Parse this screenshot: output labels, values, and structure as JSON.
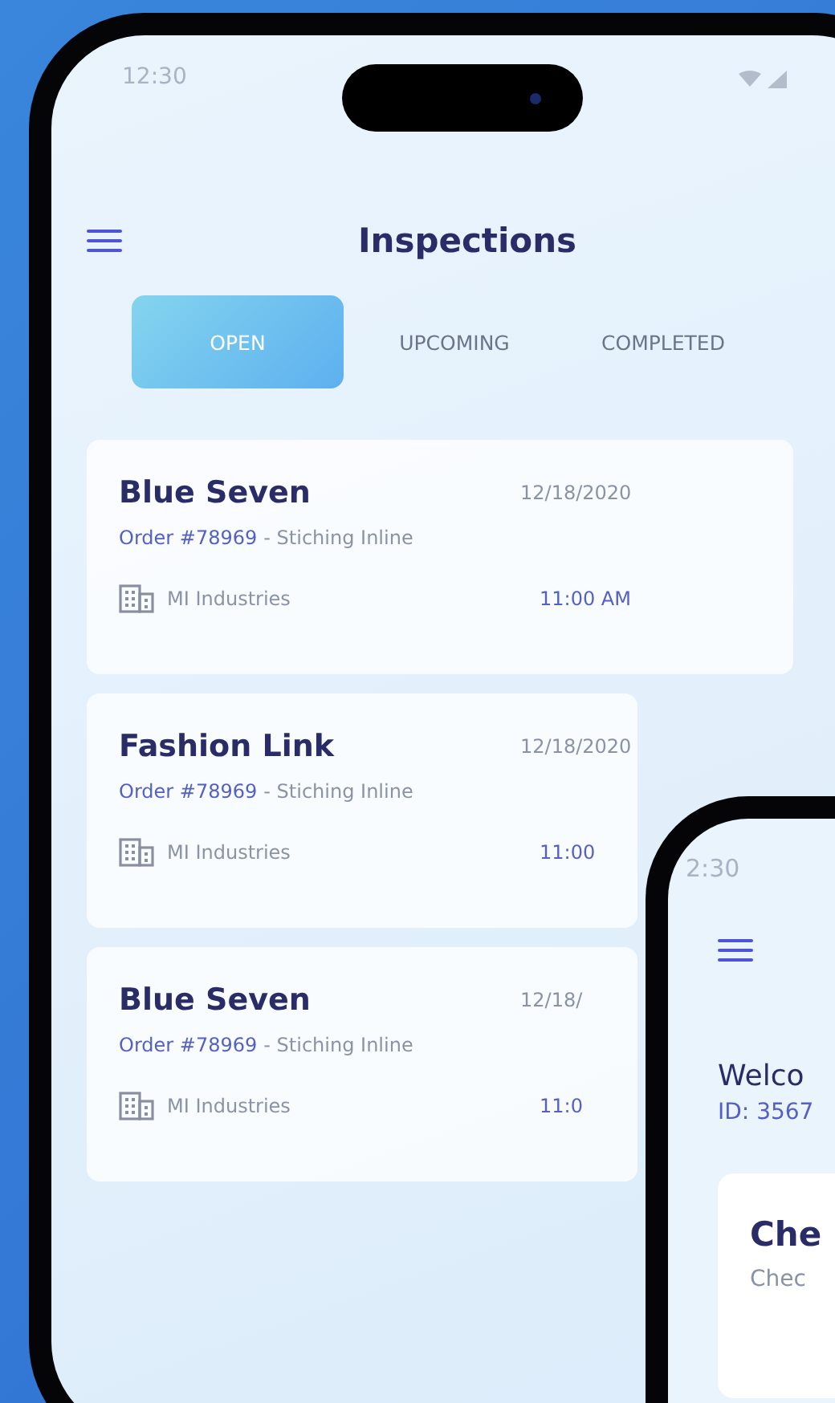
{
  "status_bar": {
    "time": "12:30"
  },
  "header": {
    "title": "Inspections"
  },
  "tabs": [
    {
      "label": "OPEN",
      "selected": true
    },
    {
      "label": "UPCOMING",
      "selected": false
    },
    {
      "label": "COMPLETED",
      "selected": false
    }
  ],
  "inspections": [
    {
      "company": "Blue Seven",
      "date": "12/18/2020",
      "order": "Order #78969",
      "task": "- Stiching Inline",
      "factory": "MI Industries",
      "time": "11:00 AM"
    },
    {
      "company": "Fashion Link",
      "date": "12/18/2020",
      "order": "Order #78969",
      "task": "- Stiching Inline",
      "factory": "MI Industries",
      "time": "11:00"
    },
    {
      "company": "Blue Seven",
      "date": "12/18/",
      "order": "Order #78969",
      "task": "- Stiching Inline",
      "factory": "MI Industries",
      "time": "11:0"
    }
  ],
  "second_phone": {
    "time": "2:30",
    "welcome": "Welco",
    "user_id": "ID: 3567",
    "card": {
      "title": "Che",
      "subtitle": "Chec"
    }
  }
}
